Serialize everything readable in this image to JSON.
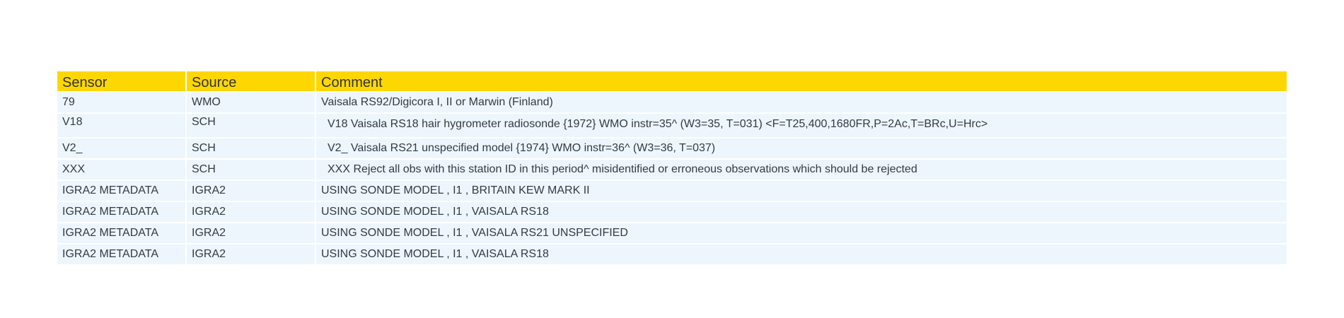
{
  "table": {
    "headers": [
      "Sensor",
      "Source",
      "Comment"
    ],
    "rows": [
      {
        "sensor": "79",
        "source": "WMO",
        "comment": "Vaisala RS92/Digicora I, II or Marwin (Finland)"
      },
      {
        "sensor": "V18",
        "source": "SCH",
        "comment": "V18 Vaisala RS18 hair hygrometer radiosonde {1972} WMO instr=35^ (W3=35, T=031) <F=T25,400,1680FR,P=2Ac,T=BRc,U=Hrc>"
      },
      {
        "sensor": "V2_",
        "source": "SCH",
        "comment": "V2_ Vaisala RS21 unspecified model {1974} WMO instr=36^ (W3=36, T=037)"
      },
      {
        "sensor": "XXX",
        "source": "SCH",
        "comment": "XXX Reject all obs with this station ID in this period^ misidentified or erroneous observations which should be rejected"
      },
      {
        "sensor": "IGRA2 METADATA",
        "source": "IGRA2",
        "comment": "USING SONDE MODEL , I1 , BRITAIN KEW MARK II"
      },
      {
        "sensor": "IGRA2 METADATA",
        "source": "IGRA2",
        "comment": "USING SONDE MODEL , I1 , VAISALA RS18"
      },
      {
        "sensor": "IGRA2 METADATA",
        "source": "IGRA2",
        "comment": "USING SONDE MODEL , I1 , VAISALA RS21 UNSPECIFIED"
      },
      {
        "sensor": "IGRA2 METADATA",
        "source": "IGRA2",
        "comment": "USING SONDE MODEL , I1 , VAISALA RS18"
      }
    ]
  },
  "colors": {
    "header_bg": "#ffd700",
    "row_bg": "#eef6fd",
    "text": "#333a44"
  }
}
